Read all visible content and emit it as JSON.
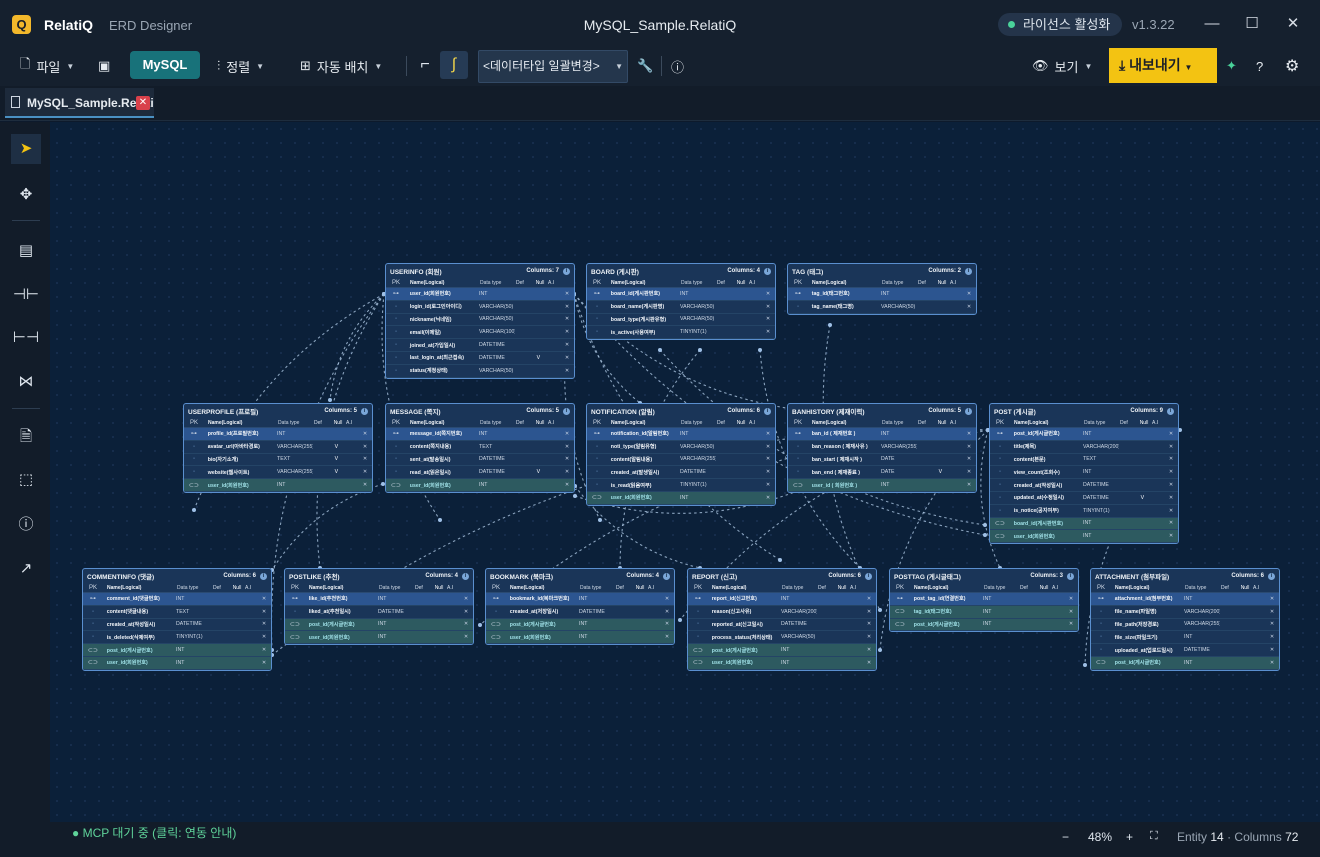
{
  "app": {
    "logo_letter": "Q",
    "name": "RelatiQ",
    "subtitle": "ERD Designer",
    "document_title": "MySQL_Sample.RelatiQ",
    "license_label": "라이선스 활성화",
    "version": "v1.3.22"
  },
  "toolbar": {
    "file_label": "파일",
    "db_label": "MySQL",
    "align_label": "정렬",
    "auto_layout_label": "자동 배치",
    "datatype_select": "<데이터타입 일괄변경>",
    "view_label": "보기",
    "export_label": "내보내기"
  },
  "tab": {
    "label": "MySQL_Sample.RelatiQ"
  },
  "table_header": {
    "pk": "PK",
    "name": "Name(Logical)",
    "type": "Data type",
    "def": "Def",
    "null": "Null",
    "ai": "A.I"
  },
  "entities": [
    {
      "title": "USERINFO (회원)",
      "cols_label": "Columns:",
      "cols": "7",
      "rows": [
        [
          "user_id(회원번호)",
          "INT",
          "",
          "pk"
        ],
        [
          "login_id(로그인아이디)",
          "VARCHAR(50)",
          "",
          ""
        ],
        [
          "nickname(닉네임)",
          "VARCHAR(50)",
          "",
          ""
        ],
        [
          "email(이메일)",
          "VARCHAR(100)",
          "",
          ""
        ],
        [
          "joined_at(가입일시)",
          "DATETIME",
          "",
          ""
        ],
        [
          "last_login_at(최근접속)",
          "DATETIME",
          "V",
          ""
        ],
        [
          "status(계정상태)",
          "VARCHAR(50)",
          "",
          ""
        ]
      ]
    },
    {
      "title": "BOARD (게시판)",
      "cols_label": "Columns:",
      "cols": "4",
      "rows": [
        [
          "board_id(게시판번호)",
          "INT",
          "",
          "pk"
        ],
        [
          "board_name(게시판명)",
          "VARCHAR(50)",
          "",
          ""
        ],
        [
          "board_type(게시판유형)",
          "VARCHAR(50)",
          "",
          ""
        ],
        [
          "is_active(사용여부)",
          "TINYINT(1)",
          "",
          ""
        ]
      ]
    },
    {
      "title": "TAG (태그)",
      "cols_label": "Columns:",
      "cols": "2",
      "rows": [
        [
          "tag_id(태그번호)",
          "INT",
          "",
          "pk"
        ],
        [
          "tag_name(태그명)",
          "VARCHAR(50)",
          "",
          ""
        ]
      ]
    },
    {
      "title": "USERPROFILE (프로필)",
      "cols_label": "Columns:",
      "cols": "5",
      "rows": [
        [
          "profile_id(프로필번호)",
          "INT",
          "",
          "pk"
        ],
        [
          "avatar_url(아바타경로)",
          "VARCHAR(255)",
          "V",
          ""
        ],
        [
          "bio(자기소개)",
          "TEXT",
          "V",
          ""
        ],
        [
          "website(웹사이트)",
          "VARCHAR(255)",
          "V",
          ""
        ],
        [
          "user_id(회원번호)",
          "INT",
          "",
          "fk"
        ]
      ]
    },
    {
      "title": "MESSAGE (쪽지)",
      "cols_label": "Columns:",
      "cols": "5",
      "rows": [
        [
          "message_id(쪽지번호)",
          "INT",
          "",
          "pk"
        ],
        [
          "content(쪽지내용)",
          "TEXT",
          "",
          ""
        ],
        [
          "sent_at(발송일시)",
          "DATETIME",
          "",
          ""
        ],
        [
          "read_at(읽은일시)",
          "DATETIME",
          "V",
          ""
        ],
        [
          "user_id(회원번호)",
          "INT",
          "",
          "fk"
        ]
      ]
    },
    {
      "title": "NOTIFICATION (알림)",
      "cols_label": "Columns:",
      "cols": "6",
      "rows": [
        [
          "notification_id(알림번호)",
          "INT",
          "",
          "pk"
        ],
        [
          "noti_type(알림유형)",
          "VARCHAR(50)",
          "",
          ""
        ],
        [
          "content(알림내용)",
          "VARCHAR(255)",
          "",
          ""
        ],
        [
          "created_at(발생일시)",
          "DATETIME",
          "",
          ""
        ],
        [
          "is_read(읽음여부)",
          "TINYINT(1)",
          "",
          ""
        ],
        [
          "user_id(회원번호)",
          "INT",
          "",
          "fk"
        ]
      ]
    },
    {
      "title": "BANHISTORY (제재이력)",
      "cols_label": "Columns:",
      "cols": "5",
      "rows": [
        [
          "ban_id ( 제재번호 )",
          "INT",
          "",
          "pk"
        ],
        [
          "ban_reason ( 제재사유 )",
          "VARCHAR(255)",
          "",
          ""
        ],
        [
          "ban_start ( 제재시작 )",
          "DATE",
          "",
          ""
        ],
        [
          "ban_end ( 제재종료 )",
          "DATE",
          "V",
          ""
        ],
        [
          "user_id ( 회원번호 )",
          "INT",
          "",
          "fk"
        ]
      ]
    },
    {
      "title": "POST (게시글)",
      "cols_label": "Columns:",
      "cols": "9",
      "rows": [
        [
          "post_id(게시글번호)",
          "INT",
          "",
          "pk"
        ],
        [
          "title(제목)",
          "VARCHAR(200)",
          "",
          ""
        ],
        [
          "content(본문)",
          "TEXT",
          "",
          ""
        ],
        [
          "view_count(조회수)",
          "INT",
          "",
          ""
        ],
        [
          "created_at(작성일시)",
          "DATETIME",
          "",
          ""
        ],
        [
          "updated_at(수정일시)",
          "DATETIME",
          "V",
          ""
        ],
        [
          "is_notice(공지여부)",
          "TINYINT(1)",
          "",
          ""
        ],
        [
          "board_id(게시판번호)",
          "INT",
          "",
          "fk"
        ],
        [
          "user_id(회원번호)",
          "INT",
          "",
          "fk"
        ]
      ]
    },
    {
      "title": "COMMENTINFO (댓글)",
      "cols_label": "Columns:",
      "cols": "6",
      "rows": [
        [
          "comment_id(댓글번호)",
          "INT",
          "",
          "pk"
        ],
        [
          "content(댓글내용)",
          "TEXT",
          "",
          ""
        ],
        [
          "created_at(작성일시)",
          "DATETIME",
          "",
          ""
        ],
        [
          "is_deleted(삭제여부)",
          "TINYINT(1)",
          "",
          ""
        ],
        [
          "post_id(게시글번호)",
          "INT",
          "",
          "fk"
        ],
        [
          "user_id(회원번호)",
          "INT",
          "",
          "fk"
        ]
      ]
    },
    {
      "title": "POSTLIKE (추천)",
      "cols_label": "Columns:",
      "cols": "4",
      "rows": [
        [
          "like_id(추천번호)",
          "INT",
          "",
          "pk"
        ],
        [
          "liked_at(추천일시)",
          "DATETIME",
          "",
          ""
        ],
        [
          "post_id(게시글번호)",
          "INT",
          "",
          "fk"
        ],
        [
          "user_id(회원번호)",
          "INT",
          "",
          "fk"
        ]
      ]
    },
    {
      "title": "BOOKMARK (북마크)",
      "cols_label": "Columns:",
      "cols": "4",
      "rows": [
        [
          "bookmark_id(북마크번호)",
          "INT",
          "",
          "pk"
        ],
        [
          "created_at(저장일시)",
          "DATETIME",
          "",
          ""
        ],
        [
          "post_id(게시글번호)",
          "INT",
          "",
          "fk"
        ],
        [
          "user_id(회원번호)",
          "INT",
          "",
          "fk"
        ]
      ]
    },
    {
      "title": "REPORT (신고)",
      "cols_label": "Columns:",
      "cols": "6",
      "rows": [
        [
          "report_id(신고번호)",
          "INT",
          "",
          "pk"
        ],
        [
          "reason(신고사유)",
          "VARCHAR(200)",
          "",
          ""
        ],
        [
          "reported_at(신고일시)",
          "DATETIME",
          "",
          ""
        ],
        [
          "process_status(처리상태)",
          "VARCHAR(50)",
          "",
          ""
        ],
        [
          "post_id(게시글번호)",
          "INT",
          "",
          "fk"
        ],
        [
          "user_id(회원번호)",
          "INT",
          "",
          "fk"
        ]
      ]
    },
    {
      "title": "POSTTAG (게시글태그)",
      "cols_label": "Columns:",
      "cols": "3",
      "rows": [
        [
          "post_tag_id(연결번호)",
          "INT",
          "",
          "pk"
        ],
        [
          "tag_id(태그번호)",
          "INT",
          "",
          "fk"
        ],
        [
          "post_id(게시글번호)",
          "INT",
          "",
          "fk"
        ]
      ]
    },
    {
      "title": "ATTACHMENT (첨부파일)",
      "cols_label": "Columns:",
      "cols": "6",
      "rows": [
        [
          "attachment_id(첨부번호)",
          "INT",
          "",
          "pk"
        ],
        [
          "file_name(파일명)",
          "VARCHAR(200)",
          "",
          ""
        ],
        [
          "file_path(저장경로)",
          "VARCHAR(255)",
          "",
          ""
        ],
        [
          "file_size(파일크기)",
          "INT",
          "",
          ""
        ],
        [
          "uploaded_at(업로드일시)",
          "DATETIME",
          "",
          ""
        ],
        [
          "post_id(게시글번호)",
          "INT",
          "",
          "fk"
        ]
      ]
    }
  ],
  "status": {
    "mcp": "● MCP 대기 중 (클릭: 연동 안내)",
    "zoom_minus": "−",
    "zoom": "48%",
    "zoom_plus": "+",
    "entity_label": "Entity",
    "entity_count": "14",
    "columns_label": "Columns",
    "columns_count": "72",
    "sep": "·"
  }
}
